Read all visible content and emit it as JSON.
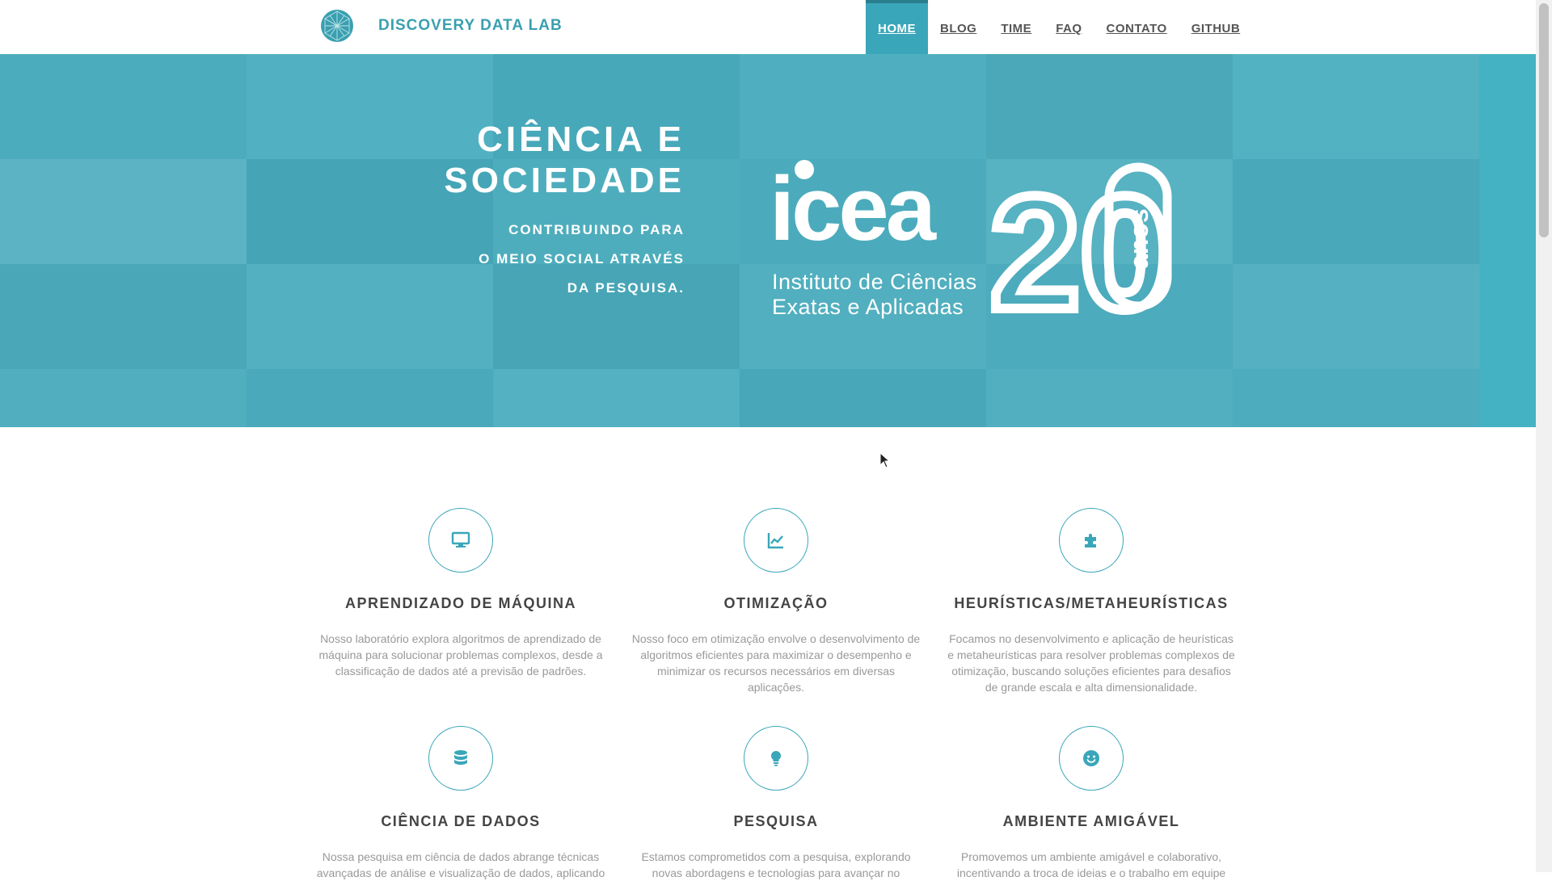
{
  "brand": {
    "name": "DISCOVERY DATA LAB",
    "logo_icon": "globe-network-icon"
  },
  "nav": [
    {
      "label": "HOME",
      "active": true
    },
    {
      "label": "BLOG",
      "active": false
    },
    {
      "label": "TIME",
      "active": false
    },
    {
      "label": "FAQ",
      "active": false
    },
    {
      "label": "CONTATO",
      "active": false
    },
    {
      "label": "GITHUB",
      "active": false
    }
  ],
  "hero": {
    "title_line1": "CIÊNCIA E",
    "title_line2": "SOCIEDADE",
    "subtitle_line1": "CONTRIBUINDO PARA",
    "subtitle_line2": "O MEIO SOCIAL ATRAVÉS",
    "subtitle_line3": "DA PESQUISA.",
    "logo_word": "icea",
    "logo_number": "20",
    "logo_anos": "anos",
    "logo_line1": "Instituto de Ciências",
    "logo_line2": "Exatas e Aplicadas",
    "slide_count": 4,
    "active_slide": 4
  },
  "features": [
    {
      "icon": "monitor-icon",
      "title": "APRENDIZADO DE MÁQUINA",
      "l1": "Nosso laboratório explora algoritmos de aprendizado de",
      "l2": "máquina para solucionar problemas complexos, desde a",
      "l3": "classificação de dados até a previsão de padrões.",
      "l4": ""
    },
    {
      "icon": "line-chart-icon",
      "title": "OTIMIZAÇÃO",
      "l1": "Nosso foco em otimização envolve o desenvolvimento de",
      "l2": "algoritmos eficientes para maximizar o desempenho e",
      "l3": "minimizar os recursos necessários em diversas",
      "l4": "aplicações."
    },
    {
      "icon": "puzzle-icon",
      "title": "HEURÍSTICAS/METAHEURÍSTICAS",
      "l1": "Focamos no desenvolvimento e aplicação de heurísticas",
      "l2": "e metaheurísticas para resolver problemas complexos de",
      "l3": "otimização, buscando soluções eficientes para desafios",
      "l4": "de grande escala e alta dimensionalidade."
    },
    {
      "icon": "database-icon",
      "title": "CIÊNCIA DE DADOS",
      "l1": "Nossa pesquisa em ciência de dados abrange técnicas",
      "l2": "avançadas de análise e visualização de dados, aplicando"
    },
    {
      "icon": "lightbulb-icon",
      "title": "PESQUISA",
      "l1": "Estamos comprometidos com a pesquisa, explorando",
      "l2": "novas abordagens e tecnologias para avançar no"
    },
    {
      "icon": "smile-icon",
      "title": "AMBIENTE AMIGÁVEL",
      "l1": "Promovemos um ambiente amigável e colaborativo,",
      "l2": "incentivando a troca de ideias e o trabalho em equipe"
    }
  ],
  "colors": {
    "accent": "#3aa6b9",
    "brand_text": "#3a9fb0",
    "heading": "#444444",
    "body_text": "#999999"
  }
}
